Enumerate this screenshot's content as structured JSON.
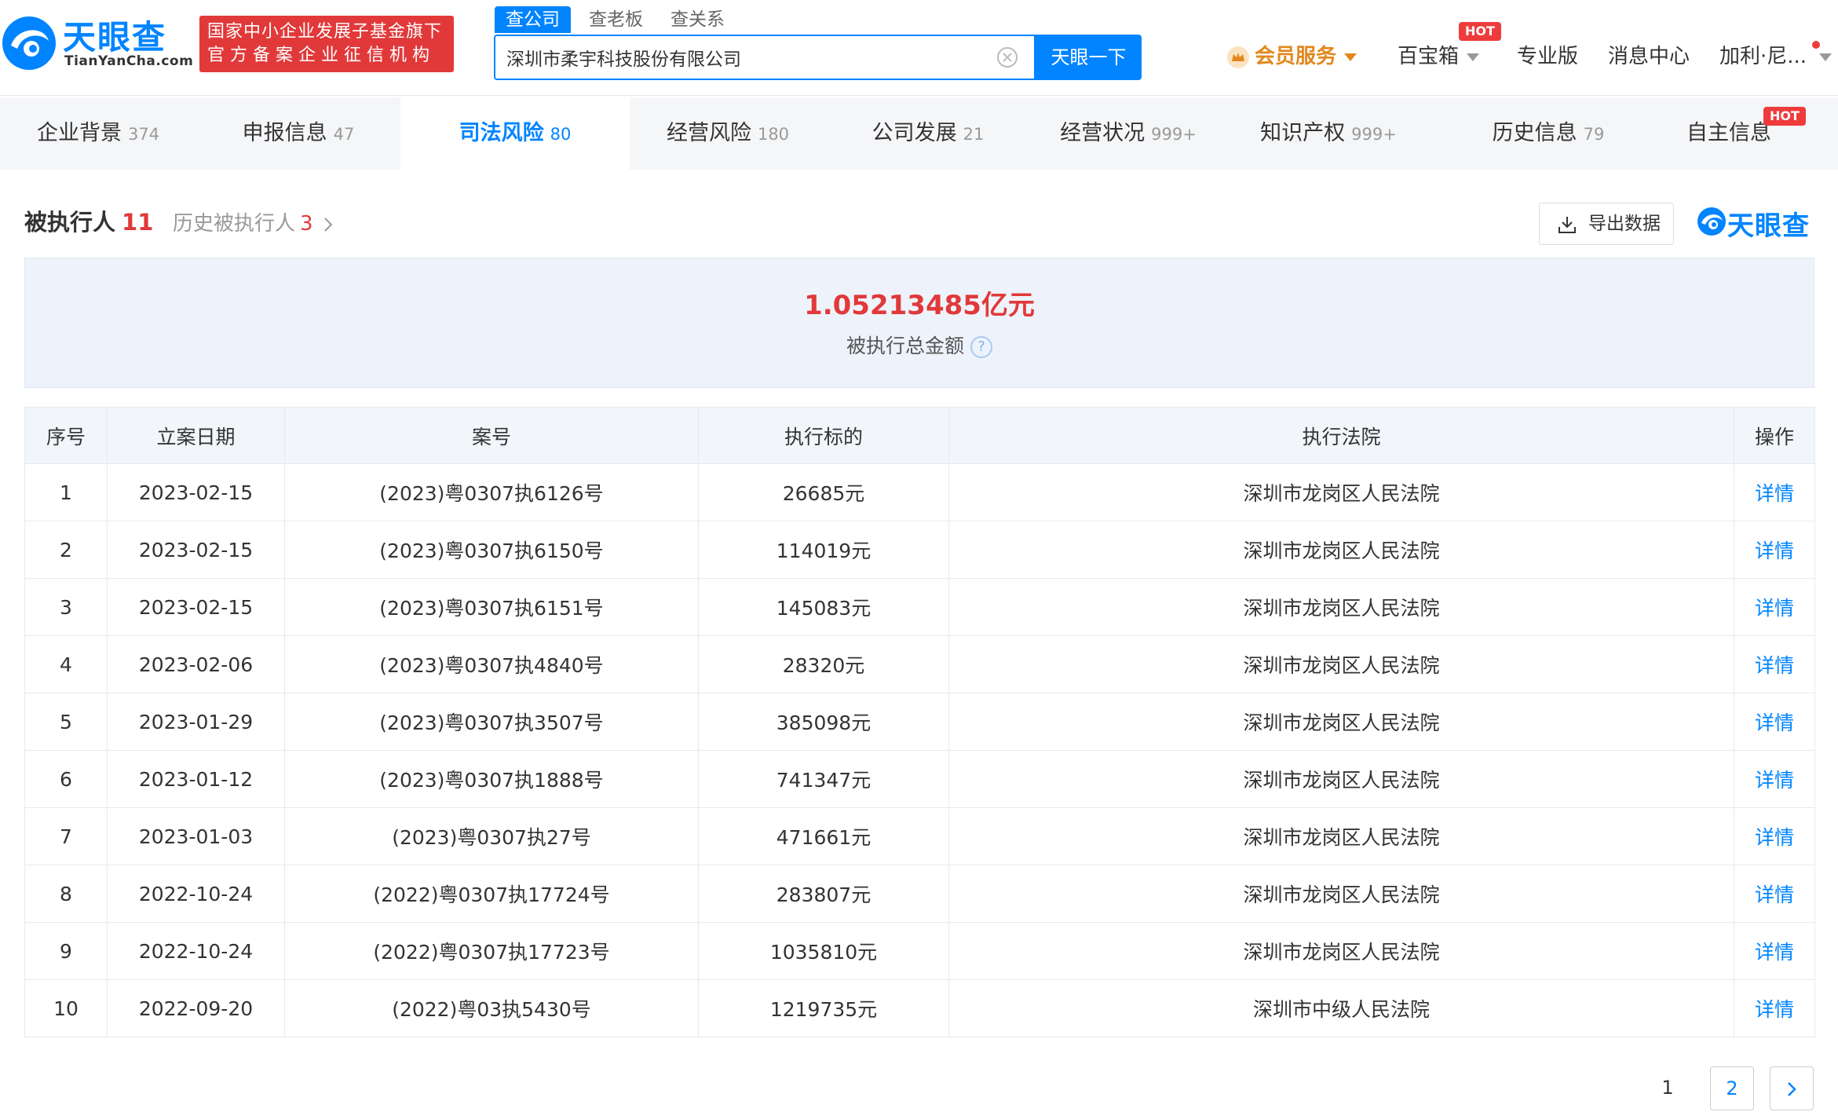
{
  "brand": {
    "cn_name": "天眼查",
    "en_name": "TianYanCha.com",
    "slogan_line1": "国家中小企业发展子基金旗下",
    "slogan_line2": "官方备案企业征信机构",
    "color": "#0084ff"
  },
  "search": {
    "tabs": [
      "查公司",
      "查老板",
      "查关系"
    ],
    "active_tab": "查公司",
    "value": "深圳市柔宇科技股份有限公司",
    "button_label": "天眼一下"
  },
  "top_nav": {
    "vip": "会员服务",
    "treasure": "百宝箱",
    "treasure_badge": "HOT",
    "pro": "专业版",
    "messages": "消息中心",
    "user": "加利·尼..."
  },
  "category_tabs": [
    {
      "label": "企业背景",
      "count": "374"
    },
    {
      "label": "申报信息",
      "count": "47"
    },
    {
      "label": "司法风险",
      "count": "80"
    },
    {
      "label": "经营风险",
      "count": "180"
    },
    {
      "label": "公司发展",
      "count": "21"
    },
    {
      "label": "经营状况",
      "count": "999+"
    },
    {
      "label": "知识产权",
      "count": "999+"
    },
    {
      "label": "历史信息",
      "count": "79"
    },
    {
      "label": "自主信息",
      "count": ""
    }
  ],
  "category_hot_badge": "HOT",
  "section": {
    "title": "被执行人",
    "count": "11",
    "history_label": "历史被执行人",
    "history_count": "3",
    "export_label": "导出数据",
    "brand_label": "天眼查"
  },
  "summary": {
    "amount": "1.05213485亿元",
    "label": "被执行总金额"
  },
  "table": {
    "headers": [
      "序号",
      "立案日期",
      "案号",
      "执行标的",
      "执行法院",
      "操作"
    ],
    "rows": [
      {
        "no": "1",
        "date": "2023-02-15",
        "case": "(2023)粤0307执6126号",
        "amount": "26685元",
        "court": "深圳市龙岗区人民法院",
        "op": "详情"
      },
      {
        "no": "2",
        "date": "2023-02-15",
        "case": "(2023)粤0307执6150号",
        "amount": "114019元",
        "court": "深圳市龙岗区人民法院",
        "op": "详情"
      },
      {
        "no": "3",
        "date": "2023-02-15",
        "case": "(2023)粤0307执6151号",
        "amount": "145083元",
        "court": "深圳市龙岗区人民法院",
        "op": "详情"
      },
      {
        "no": "4",
        "date": "2023-02-06",
        "case": "(2023)粤0307执4840号",
        "amount": "28320元",
        "court": "深圳市龙岗区人民法院",
        "op": "详情"
      },
      {
        "no": "5",
        "date": "2023-01-29",
        "case": "(2023)粤0307执3507号",
        "amount": "385098元",
        "court": "深圳市龙岗区人民法院",
        "op": "详情"
      },
      {
        "no": "6",
        "date": "2023-01-12",
        "case": "(2023)粤0307执1888号",
        "amount": "741347元",
        "court": "深圳市龙岗区人民法院",
        "op": "详情"
      },
      {
        "no": "7",
        "date": "2023-01-03",
        "case": "(2023)粤0307执27号",
        "amount": "471661元",
        "court": "深圳市龙岗区人民法院",
        "op": "详情"
      },
      {
        "no": "8",
        "date": "2022-10-24",
        "case": "(2022)粤0307执17724号",
        "amount": "283807元",
        "court": "深圳市龙岗区人民法院",
        "op": "详情"
      },
      {
        "no": "9",
        "date": "2022-10-24",
        "case": "(2022)粤0307执17723号",
        "amount": "1035810元",
        "court": "深圳市龙岗区人民法院",
        "op": "详情"
      },
      {
        "no": "10",
        "date": "2022-09-20",
        "case": "(2022)粤03执5430号",
        "amount": "1219735元",
        "court": "深圳市中级人民法院",
        "op": "详情"
      }
    ]
  },
  "pagination": {
    "pages": [
      "1",
      "2"
    ],
    "current": "1",
    "next_icon": "chevron-right-icon"
  },
  "colors": {
    "accent": "#0084ff",
    "alert_red": "#e1393a",
    "vip_orange": "#e2871e"
  }
}
